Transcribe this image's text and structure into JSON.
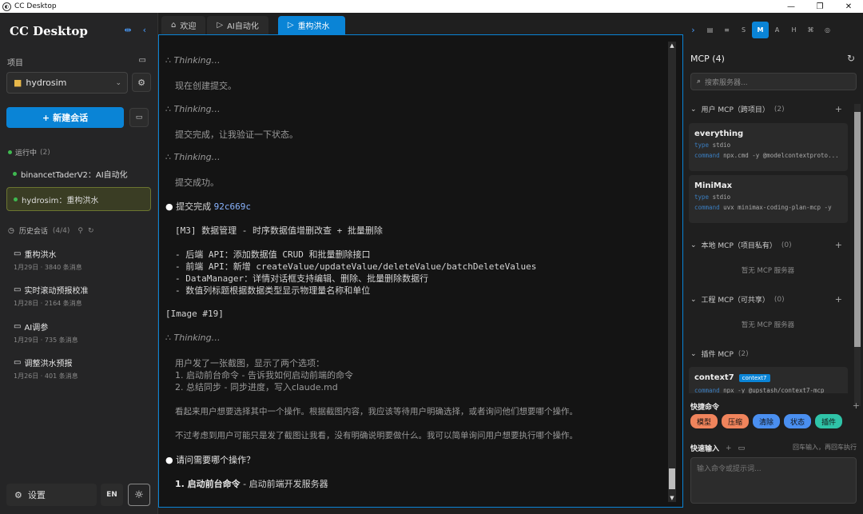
{
  "window": {
    "title": "CC Desktop",
    "btn_min": "—",
    "btn_max": "❐",
    "btn_close": "✕"
  },
  "sidebar": {
    "brand": "CC Desktop",
    "project_label": "项目",
    "project_value": "hydrosim",
    "new_chat": "新建会话",
    "running_label": "运行中",
    "running_count": "(2)",
    "running": [
      {
        "label": "binancetTaderV2：AI自动化"
      },
      {
        "label": "hydrosim：重构洪水"
      }
    ],
    "history_label": "历史会话",
    "history_count": "(4/4)",
    "history": [
      {
        "title": "重构洪水",
        "meta": "1月29日 · 3840 条消息"
      },
      {
        "title": "实时滚动预报校准",
        "meta": "1月28日 · 2164 条消息"
      },
      {
        "title": "AI调参",
        "meta": "1月29日 · 735 条消息"
      },
      {
        "title": "调整洪水预报",
        "meta": "1月26日 · 401 条消息"
      }
    ],
    "settings": "设置",
    "lang": "EN"
  },
  "tabs": [
    {
      "label": "欢迎",
      "icon": "home-icon"
    },
    {
      "label": "AI自动化",
      "icon": "play-icon"
    },
    {
      "label": "重构洪水",
      "icon": "play-icon"
    }
  ],
  "terminal": {
    "thinking": "Thinking…",
    "l1": "现在创建提交。",
    "l2": "提交完成，让我验证一下状态。",
    "l3": "提交成功。",
    "commit_label": "提交完成 ",
    "commit_hash": "92c669c",
    "c1": "[M3] 数据管理 - 时序数据值增删改查 + 批量删除",
    "c2": "- 后端 API：添加数据值 CRUD 和批量删除接口",
    "c3": "- 前端 API：新增 createValue/updateValue/deleteValue/batchDeleteValues",
    "c4": "- DataManager：详情对话框支持编辑、删除、批量删除数据行",
    "c5": "- 数值列标题根据数据类型显示物理量名称和单位",
    "image": "[Image #19]",
    "u1": "用户发了一张截图，显示了两个选项：",
    "u2": "1. 启动前台命令 - 告诉我如何启动前端的命令",
    "u3": "2. 总结同步 - 同步进度，写入claude.md",
    "u4": "看起来用户想要选择其中一个操作。根据截图内容，我应该等待用户明确选择，或者询问他们想要哪个操作。",
    "u5": "不过考虑到用户可能只是发了截图让我看，没有明确说明要做什么。我可以简单询问用户想要执行哪个操作。",
    "q": "请问需要哪个操作？",
    "opt_bold": "1. 启动前台命令",
    "opt_rest": " - 启动前端开发服务器"
  },
  "rpanel": {
    "tools": [
      "›",
      "▤",
      "≡",
      "S",
      "M",
      "A",
      "H",
      "⌘",
      "◎"
    ],
    "mcp_title": "MCP (4)",
    "search_placeholder": "搜索服务器...",
    "user_group": "用户 MCP（跨项目）",
    "user_count": "(2)",
    "servers": [
      {
        "name": "everything",
        "type": "stdio",
        "command": "npx.cmd -y @modelcontextproto..."
      },
      {
        "name": "MiniMax",
        "type": "stdio",
        "command": "uvx minimax-coding-plan-mcp -y"
      }
    ],
    "type_key": "type",
    "command_key": "command",
    "local_group": "本地 MCP（项目私有）",
    "local_count": "(0)",
    "local_empty": "暂无 MCP 服务器",
    "proj_group": "工程 MCP（可共享）",
    "proj_count": "(0)",
    "proj_empty": "暂无 MCP 服务器",
    "plugin_group": "插件 MCP",
    "plugin_count": "(2)",
    "plugin_server": "context7",
    "plugin_badge": "context7",
    "plugin_cmd": "npx -y @upstash/context7-mcp",
    "quick_cmd_title": "快捷命令",
    "pills": [
      {
        "label": "模型",
        "color": "#f0845c"
      },
      {
        "label": "压缩",
        "color": "#f0845c"
      },
      {
        "label": "清除",
        "color": "#4a8ff0"
      },
      {
        "label": "状态",
        "color": "#4a8ff0"
      },
      {
        "label": "插件",
        "color": "#2fc4a8"
      }
    ],
    "quick_input_title": "快速输入",
    "quick_input_hint": "回车输入，再回车执行",
    "quick_input_placeholder": "输入命令或提示词..."
  }
}
